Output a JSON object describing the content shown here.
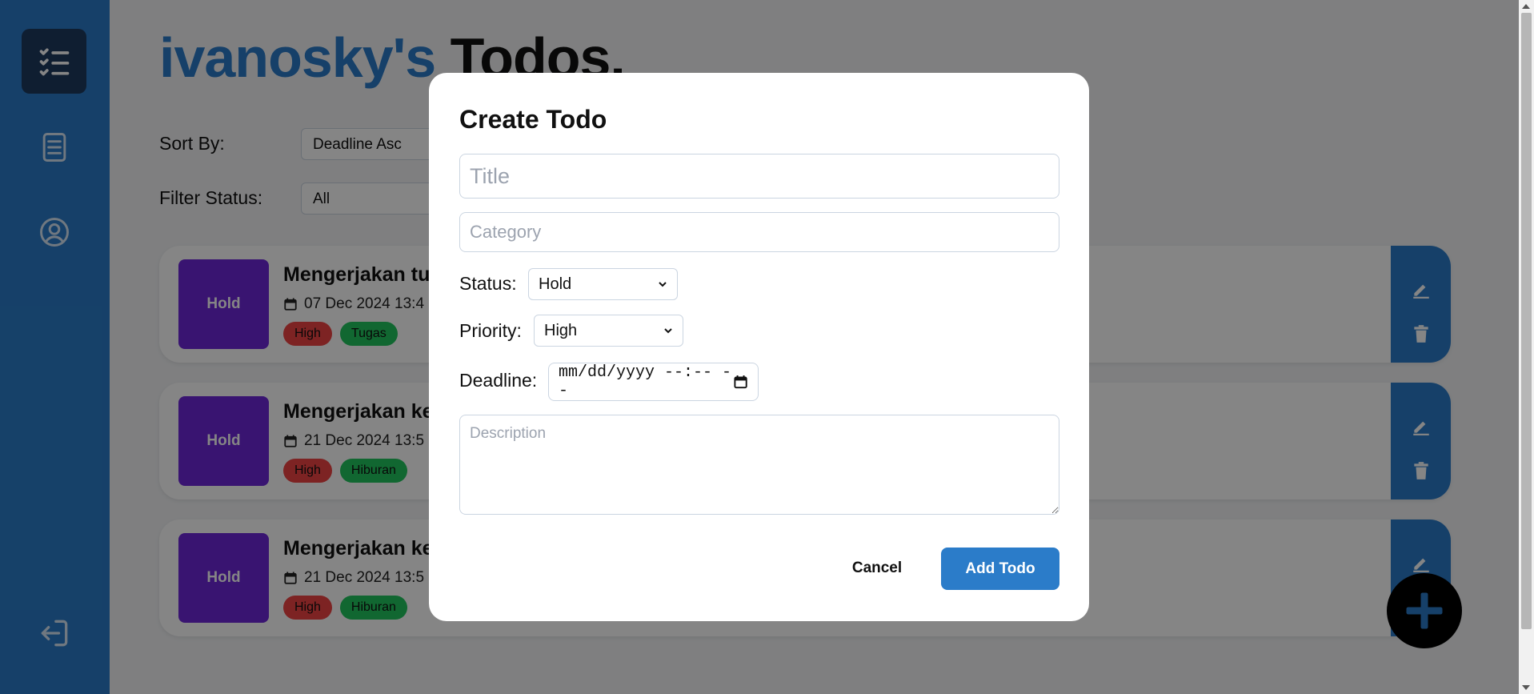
{
  "header": {
    "username": "ivanosky's",
    "title_suffix": "Todos."
  },
  "sidebar": {
    "items": [
      {
        "name": "todo-list-icon"
      },
      {
        "name": "document-icon"
      },
      {
        "name": "user-profile-icon"
      },
      {
        "name": "logout-icon"
      }
    ]
  },
  "controls": {
    "sort_label": "Sort By:",
    "sort_value": "Deadline Asc",
    "filter_label": "Filter Status:",
    "filter_value": "All"
  },
  "todos": [
    {
      "status": "Hold",
      "title": "Mengerjakan tu",
      "date": "07 Dec 2024 13:4",
      "priority": "High",
      "category": "Tugas"
    },
    {
      "status": "Hold",
      "title": "Mengerjakan ke",
      "date": "21 Dec 2024 13:5",
      "priority": "High",
      "category": "Hiburan"
    },
    {
      "status": "Hold",
      "title": "Mengerjakan ke",
      "date": "21 Dec 2024 13:5",
      "priority": "High",
      "category": "Hiburan"
    }
  ],
  "modal": {
    "title": "Create Todo",
    "title_placeholder": "Title",
    "category_placeholder": "Category",
    "status_label": "Status:",
    "status_value": "Hold",
    "priority_label": "Priority:",
    "priority_value": "High",
    "deadline_label": "Deadline:",
    "deadline_placeholder": "mm/dd/yyyy --:-- --",
    "description_placeholder": "Description",
    "cancel_label": "Cancel",
    "add_label": "Add Todo"
  },
  "colors": {
    "primary": "#2b7cc9",
    "sidebar_active": "#1e3a5f",
    "status_hold": "#6d28d9",
    "priority_high": "#ef4444",
    "category": "#22c55e"
  }
}
